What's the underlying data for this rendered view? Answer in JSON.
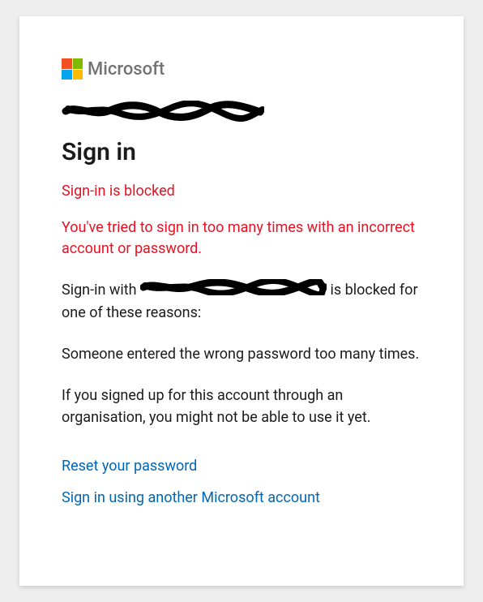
{
  "logo": {
    "brand": "Microsoft"
  },
  "title": "Sign in",
  "error": {
    "heading": "Sign-in is blocked",
    "message": "You've tried to sign in too many times with an incorrect account or password."
  },
  "blocked": {
    "prefix": "Sign-in with ",
    "suffix": " is blocked for one of these reasons:"
  },
  "reasons": {
    "r1": "Someone entered the wrong password too many times.",
    "r2": "If you signed up for this account through an organisation, you might not be able to use it yet."
  },
  "links": {
    "reset": "Reset your password",
    "another": "Sign in using another Microsoft account"
  }
}
